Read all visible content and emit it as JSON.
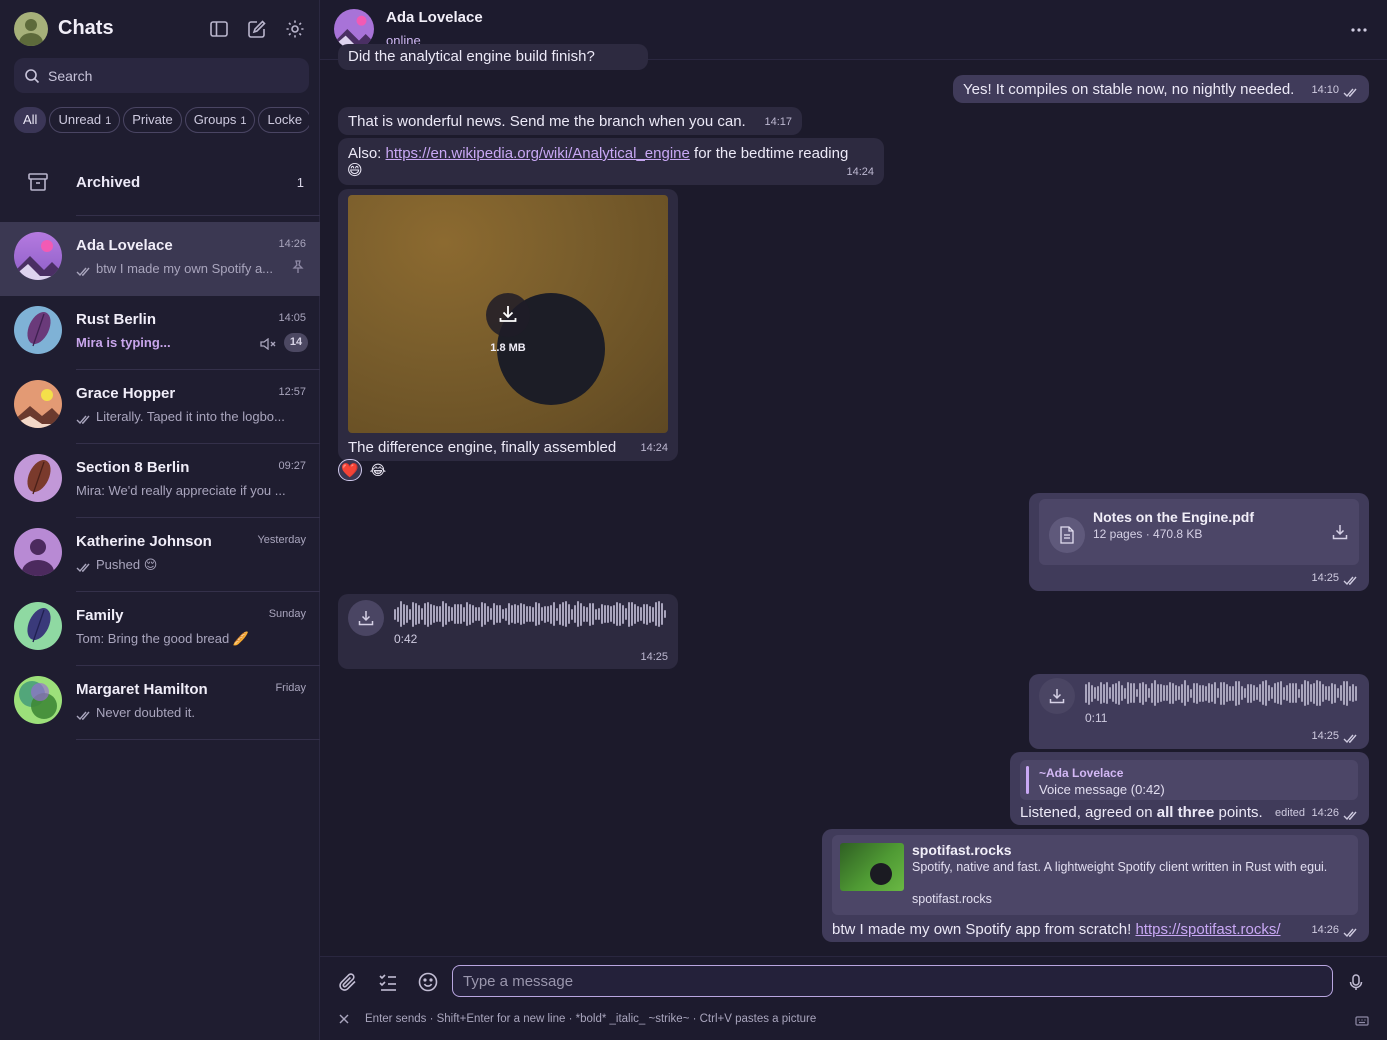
{
  "sidebar": {
    "title": "Chats",
    "search_placeholder": "Search",
    "filters": [
      {
        "label": "All",
        "count": ""
      },
      {
        "label": "Unread",
        "count": "1"
      },
      {
        "label": "Private",
        "count": ""
      },
      {
        "label": "Groups",
        "count": "1"
      },
      {
        "label": "Locke",
        "count": ""
      }
    ],
    "archived": {
      "label": "Archived",
      "count": "1"
    },
    "chats": [
      {
        "name": "Ada Lovelace",
        "time": "14:26",
        "preview": "btw I made my own Spotify a..."
      },
      {
        "name": "Rust Berlin",
        "time": "14:05",
        "preview": "Mira is typing...",
        "badge": "14"
      },
      {
        "name": "Grace Hopper",
        "time": "12:57",
        "preview": "Literally. Taped it into the logbo..."
      },
      {
        "name": "Section 8 Berlin",
        "time": "09:27",
        "preview": "Mira: We'd really appreciate if you ..."
      },
      {
        "name": "Katherine Johnson",
        "time": "Yesterday",
        "preview": "Pushed 😌"
      },
      {
        "name": "Family",
        "time": "Sunday",
        "preview": "Tom: Bring the good bread 🥖"
      },
      {
        "name": "Margaret Hamilton",
        "time": "Friday",
        "preview": "Never doubted it."
      }
    ]
  },
  "conversation": {
    "name": "Ada Lovelace",
    "status": "online",
    "messages": {
      "cut_off": "Did the analytical engine build finish?",
      "m1": {
        "text": "Yes! It compiles on stable now, no nightly needed.",
        "time": "14:10"
      },
      "m2": {
        "text": "That is wonderful news. Send me the branch when you can.",
        "time": "14:17"
      },
      "m3": {
        "prefix": "Also: ",
        "link": "https://en.wikipedia.org/wiki/Analytical_engine",
        "suffix": " for the bedtime reading",
        "emoji": "😄",
        "time": "14:24"
      },
      "m4": {
        "size": "1.8 MB",
        "caption": "The difference engine, finally assembled",
        "time": "14:24",
        "reactions": [
          "❤️",
          "😂"
        ]
      },
      "m5": {
        "file_name": "Notes on the Engine.pdf",
        "file_meta": "12 pages · 470.8 KB",
        "time": "14:25"
      },
      "m6": {
        "duration": "0:42",
        "time": "14:25"
      },
      "m7": {
        "duration": "0:11",
        "time": "14:25"
      },
      "m8": {
        "quote_name": "~Ada Lovelace",
        "quote_text": "Voice message (0:42)",
        "text_before": "Listened, agreed on ",
        "text_bold": "all three",
        "text_after": " points.",
        "edited": "edited",
        "time": "14:26"
      },
      "m9": {
        "lp_title": "spotifast.rocks",
        "lp_desc": "Spotify, native and fast. A lightweight Spotify client written in Rust with egui.",
        "lp_site": "spotifast.rocks",
        "text": "btw I made my own Spotify app from scratch! ",
        "link": "https://spotifast.rocks/",
        "time": "14:26"
      }
    }
  },
  "composer": {
    "placeholder": "Type a message",
    "hint": "Enter sends · Shift+Enter for a new line · *bold* _italic_ ~strike~ · Ctrl+V pastes a picture"
  },
  "colors": {
    "accent": "#c9a8f5",
    "incoming": "#2d2a40",
    "outgoing": "#403b5a",
    "background": "#1c1a2b"
  }
}
